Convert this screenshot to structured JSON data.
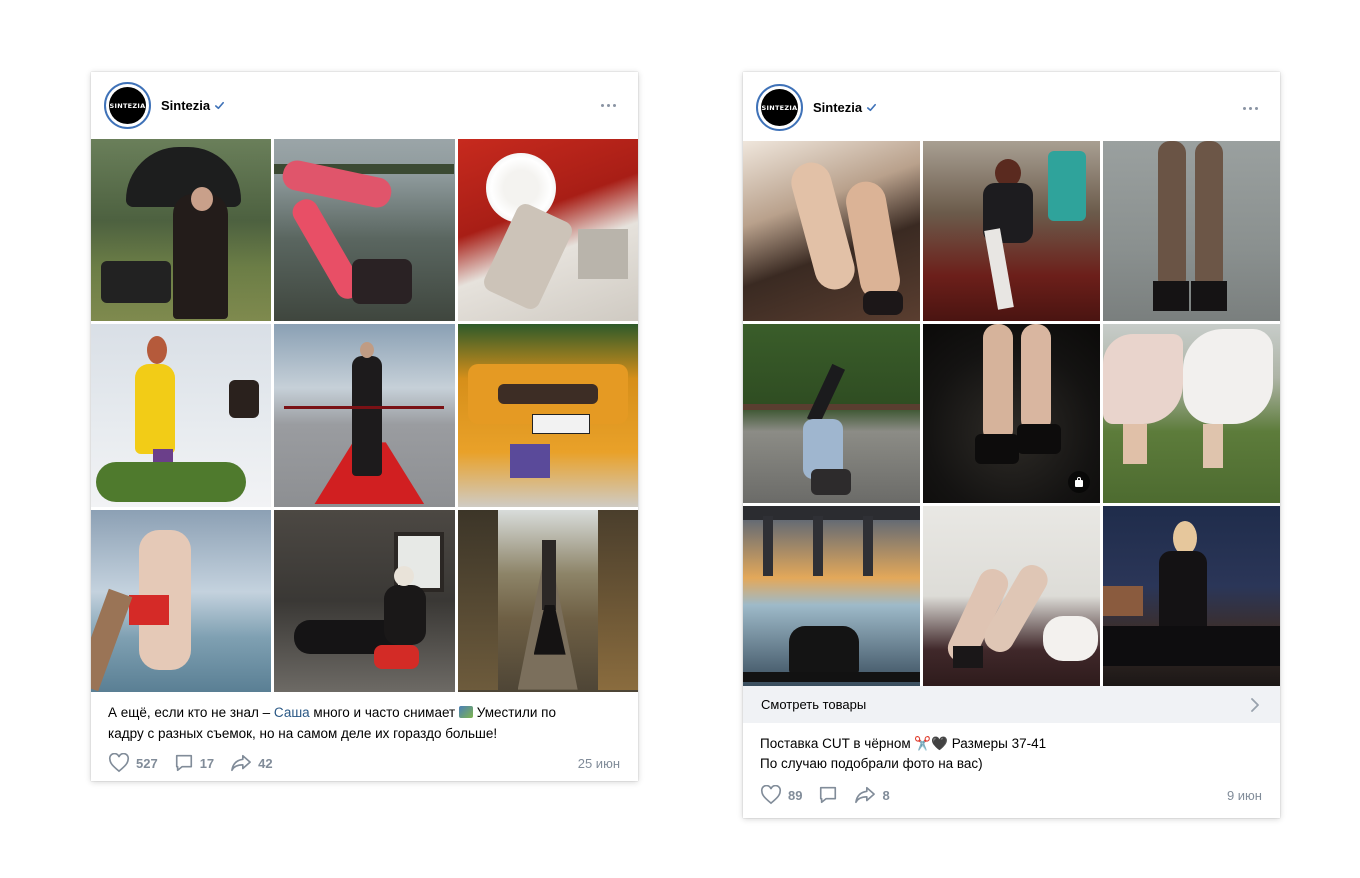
{
  "posts": [
    {
      "author": "Sintezia",
      "avatar_text": "SINTEZIA",
      "caption_line1_a": "А ещё, если кто не знал – ",
      "caption_link": "Саша",
      "caption_line1_b": " много и часто снимает",
      "caption_line1_c": " Уместили по",
      "caption_line2": "кадру с разных съемок, но на самом деле их гораздо больше!",
      "likes": "527",
      "comments": "17",
      "shares": "42",
      "date": "25 июн",
      "photos": [
        "photo-umbrella",
        "photo-red-tights-water",
        "photo-white-collar",
        "photo-yellow-dress-snow",
        "photo-red-carpet",
        "photo-yellow-car",
        "photo-ice-hole",
        "photo-red-suit-room",
        "photo-railway"
      ]
    },
    {
      "author": "Sintezia",
      "avatar_text": "SINTEZIA",
      "shop_label": "Смотреть товары",
      "caption_line1": "Поставка CUT в чёрном ✂️🖤 Размеры 37-41",
      "caption_line2": "По случаю подобрали фото на вас)",
      "likes": "89",
      "shares": "8",
      "date": "9 июн",
      "photos": [
        "photo-legs-sandals",
        "photo-girl-table",
        "photo-legs-closeup",
        "photo-handstand",
        "photo-feet-water",
        "photo-white-skirts",
        "photo-bridge-sunset",
        "photo-lying-white",
        "photo-night-railing"
      ]
    }
  ],
  "colors": {
    "accent": "#2a5885",
    "muted": "#818c99",
    "verified": "#3f72b8",
    "shop_bar": "#f0f2f5"
  }
}
